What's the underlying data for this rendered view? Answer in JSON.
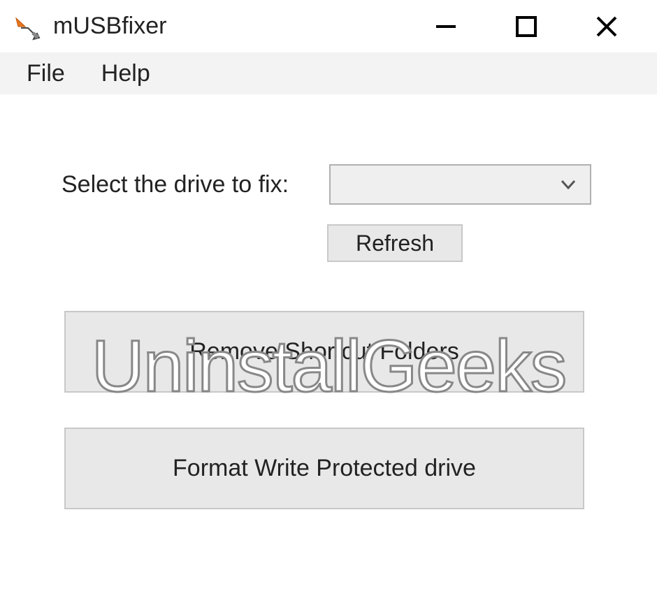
{
  "titlebar": {
    "app_title": "mUSBfixer"
  },
  "menubar": {
    "file": "File",
    "help": "Help"
  },
  "main": {
    "select_label": "Select the drive to fix:",
    "dropdown_value": "",
    "refresh_label": "Refresh",
    "button1_label": "Remove Shortcut Folders",
    "button2_label": "Format Write Protected drive"
  },
  "watermark": "UninstallGeeks"
}
